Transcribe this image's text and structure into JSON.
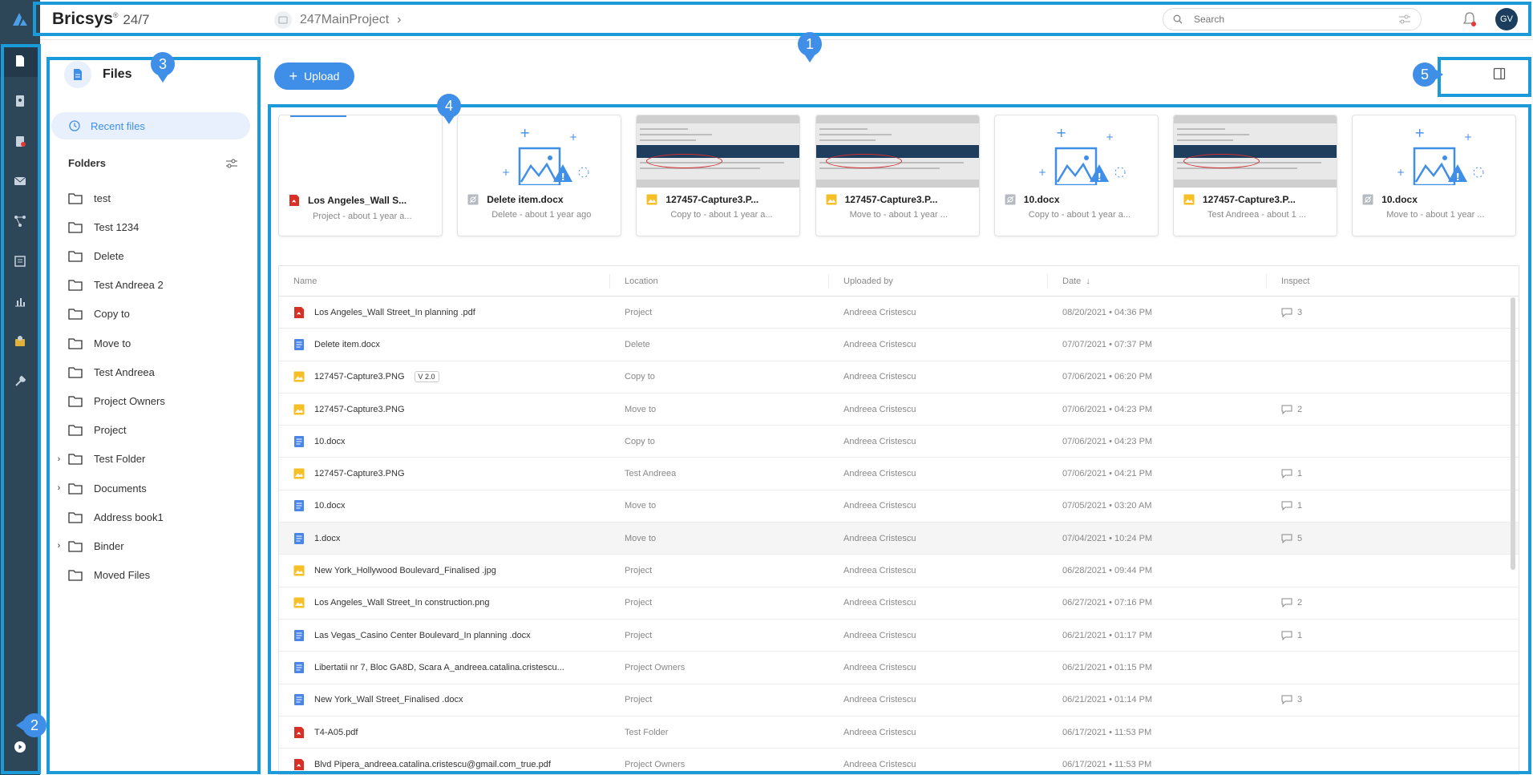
{
  "app": {
    "brand": "Bricsys",
    "brand_reg": "®",
    "brand_version": "24/7",
    "project": "247MainProject",
    "user_initials": "GV"
  },
  "search": {
    "placeholder": "Search"
  },
  "badges": [
    "1",
    "2",
    "3",
    "4",
    "5"
  ],
  "rail_icons": [
    "bricsys-logo-icon",
    "documents-icon",
    "contacts-icon",
    "issues-icon",
    "mail-icon",
    "workflow-icon",
    "forms-icon",
    "reports-icon",
    "beta-icon",
    "tools-icon",
    "play-icon"
  ],
  "sidebar": {
    "title": "Files",
    "recent": "Recent files",
    "folders_label": "Folders",
    "folders": [
      {
        "label": "test",
        "expandable": false
      },
      {
        "label": "Test 1234",
        "expandable": false
      },
      {
        "label": "Delete",
        "expandable": false
      },
      {
        "label": "Test Andreea 2",
        "expandable": false
      },
      {
        "label": "Copy to",
        "expandable": false
      },
      {
        "label": "Move to",
        "expandable": false
      },
      {
        "label": "Test Andreea",
        "expandable": false
      },
      {
        "label": "Project Owners",
        "expandable": false
      },
      {
        "label": "Project",
        "expandable": false
      },
      {
        "label": "Test Folder",
        "expandable": true
      },
      {
        "label": "Documents",
        "expandable": true
      },
      {
        "label": "Address book1",
        "expandable": false
      },
      {
        "label": "Binder",
        "expandable": true
      },
      {
        "label": "Moved Files",
        "expandable": false
      }
    ]
  },
  "main": {
    "upload": "Upload",
    "cards": [
      {
        "name": "Los Angeles_Wall S...",
        "sub": "Project - about 1 year a...",
        "type": "pdf",
        "thumb": "blank"
      },
      {
        "name": "Delete item.docx",
        "sub": "Delete - about 1 year ago",
        "type": "hidden",
        "thumb": "placeholder"
      },
      {
        "name": "127457-Capture3.P...",
        "sub": "Copy to - about 1 year a...",
        "type": "image",
        "thumb": "screenshot"
      },
      {
        "name": "127457-Capture3.P...",
        "sub": "Move to - about 1 year ...",
        "type": "image",
        "thumb": "screenshot"
      },
      {
        "name": "10.docx",
        "sub": "Copy to - about 1 year a...",
        "type": "hidden",
        "thumb": "placeholder"
      },
      {
        "name": "127457-Capture3.P...",
        "sub": "Test Andreea - about 1 ...",
        "type": "image",
        "thumb": "screenshot"
      },
      {
        "name": "10.docx",
        "sub": "Move to - about 1 year ...",
        "type": "hidden",
        "thumb": "placeholder"
      }
    ],
    "columns": [
      "Name",
      "Location",
      "Uploaded by",
      "Date",
      "Inspect"
    ],
    "rows": [
      {
        "name": "Los Angeles_Wall Street_In planning .pdf",
        "type": "pdf",
        "location": "Project",
        "by": "Andreea Cristescu",
        "date": "08/20/2021 • 04:36 PM",
        "comments": "3"
      },
      {
        "name": "Delete item.docx",
        "type": "doc",
        "location": "Delete",
        "by": "Andreea Cristescu",
        "date": "07/07/2021 • 07:37 PM",
        "comments": ""
      },
      {
        "name": "127457-Capture3.PNG",
        "type": "image",
        "version": "V 2.0",
        "location": "Copy to",
        "by": "Andreea Cristescu",
        "date": "07/06/2021 • 06:20 PM",
        "comments": ""
      },
      {
        "name": "127457-Capture3.PNG",
        "type": "image",
        "location": "Move to",
        "by": "Andreea Cristescu",
        "date": "07/06/2021 • 04:23 PM",
        "comments": "2"
      },
      {
        "name": "10.docx",
        "type": "doc",
        "location": "Copy to",
        "by": "Andreea Cristescu",
        "date": "07/06/2021 • 04:23 PM",
        "comments": ""
      },
      {
        "name": "127457-Capture3.PNG",
        "type": "image",
        "location": "Test Andreea",
        "by": "Andreea Cristescu",
        "date": "07/06/2021 • 04:21 PM",
        "comments": "1"
      },
      {
        "name": "10.docx",
        "type": "doc",
        "location": "Move to",
        "by": "Andreea Cristescu",
        "date": "07/05/2021 • 03:20 AM",
        "comments": "1"
      },
      {
        "name": "1.docx",
        "type": "doc",
        "location": "Move to",
        "by": "Andreea Cristescu",
        "date": "07/04/2021 • 10:24 PM",
        "comments": "5"
      },
      {
        "name": "New York_Hollywood Boulevard_Finalised .jpg",
        "type": "image",
        "location": "Project",
        "by": "Andreea Cristescu",
        "date": "06/28/2021 • 09:44 PM",
        "comments": ""
      },
      {
        "name": "Los Angeles_Wall Street_In construction.png",
        "type": "image",
        "location": "Project",
        "by": "Andreea Cristescu",
        "date": "06/27/2021 • 07:16 PM",
        "comments": "2"
      },
      {
        "name": "Las Vegas_Casino Center Boulevard_In planning .docx",
        "type": "doc",
        "location": "Project",
        "by": "Andreea Cristescu",
        "date": "06/21/2021 • 01:17 PM",
        "comments": "1"
      },
      {
        "name": "Libertatii nr 7, Bloc GA8D, Scara A_andreea.catalina.cristescu...",
        "type": "doc",
        "location": "Project Owners",
        "by": "Andreea Cristescu",
        "date": "06/21/2021 • 01:15 PM",
        "comments": ""
      },
      {
        "name": "New York_Wall Street_Finalised .docx",
        "type": "doc",
        "location": "Project",
        "by": "Andreea Cristescu",
        "date": "06/21/2021 • 01:14 PM",
        "comments": "3"
      },
      {
        "name": "T4-A05.pdf",
        "type": "pdf",
        "location": "Test Folder",
        "by": "Andreea Cristescu",
        "date": "06/17/2021 • 11:53 PM",
        "comments": ""
      },
      {
        "name": "Blvd Pipera_andreea.catalina.cristescu@gmail.com_true.pdf",
        "type": "pdf",
        "location": "Project Owners",
        "by": "Andreea Cristescu",
        "date": "06/17/2021 • 11:53 PM",
        "comments": ""
      }
    ]
  },
  "colors": {
    "accent": "#3f8ee8",
    "rail": "#2d4658",
    "frame": "#1a9ad9",
    "pdf": "#d93025",
    "doc": "#4a86e8",
    "image": "#f6bf26"
  }
}
